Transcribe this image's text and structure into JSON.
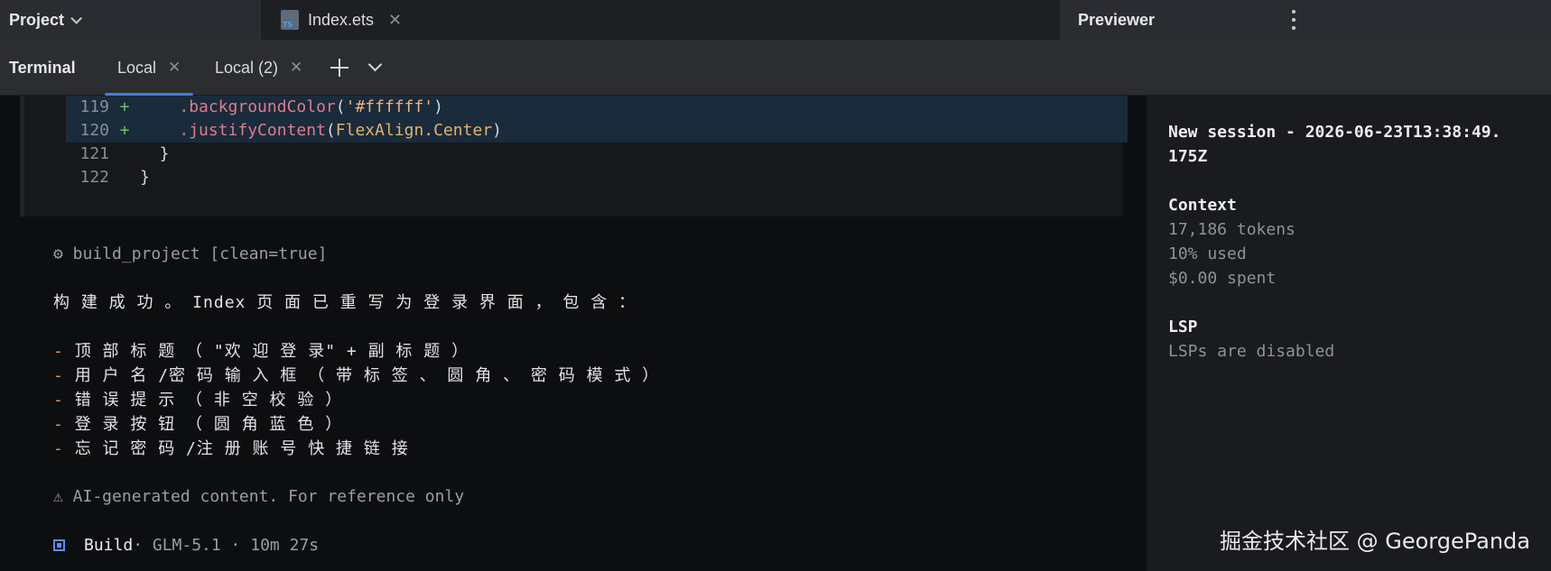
{
  "topbar": {
    "project_label": "Project",
    "file_tab": {
      "label": "Index.ets",
      "icon": "typescript-file-icon"
    },
    "previewer_label": "Previewer"
  },
  "terminal_bar": {
    "title": "Terminal",
    "tabs": [
      {
        "label": "Local",
        "active": true
      },
      {
        "label": "Local (2)",
        "active": false
      }
    ]
  },
  "diff": {
    "lines": [
      {
        "num": "119",
        "mark": "+",
        "indent": "    ",
        "dot": ".",
        "method": "backgroundColor",
        "open": "(",
        "arg": "'#ffffff'",
        "close": ")"
      },
      {
        "num": "120",
        "mark": "+",
        "indent": "    ",
        "dot": ".",
        "method": "justifyContent",
        "open": "(",
        "arg": "FlexAlign.Center",
        "close": ")"
      },
      {
        "num": "121",
        "mark": "",
        "text": "  }"
      },
      {
        "num": "122",
        "mark": "",
        "text": "}"
      }
    ]
  },
  "output": {
    "tool_call": "⚙ build_project [clean=true]",
    "summary": "构 建 成 功 。 Index 页 面 已 重 写 为 登 录 界 面 ， 包 含 ：",
    "bullets": [
      "顶 部 标 题 （ \"欢 迎 登 录\" + 副 标 题 ）",
      "用 户 名 /密 码 输 入 框 （ 带 标 签 、 圆 角 、 密 码 模 式 ）",
      "错 误 提 示 （ 非 空 校 验 ）",
      "登 录 按 钮 （ 圆 角 蓝 色 ）",
      "忘 记 密 码 /注 册 账 号 快 捷 链 接"
    ],
    "bullet_marker": "-",
    "warning": "⚠  AI-generated content. For reference only",
    "status": {
      "build": "Build",
      "meta": " · GLM-5.1 · 10m 27s"
    }
  },
  "side_panel": {
    "session_title_1": "New session - 2026-06-23T13:38:49.",
    "session_title_2": "175Z",
    "context_title": "Context",
    "tokens": "17,186 tokens",
    "used": "10% used",
    "spent": "$0.00 spent",
    "lsp_title": "LSP",
    "lsp_status": "LSPs are disabled"
  },
  "watermark": "掘金技术社区 @ GeorgePanda"
}
